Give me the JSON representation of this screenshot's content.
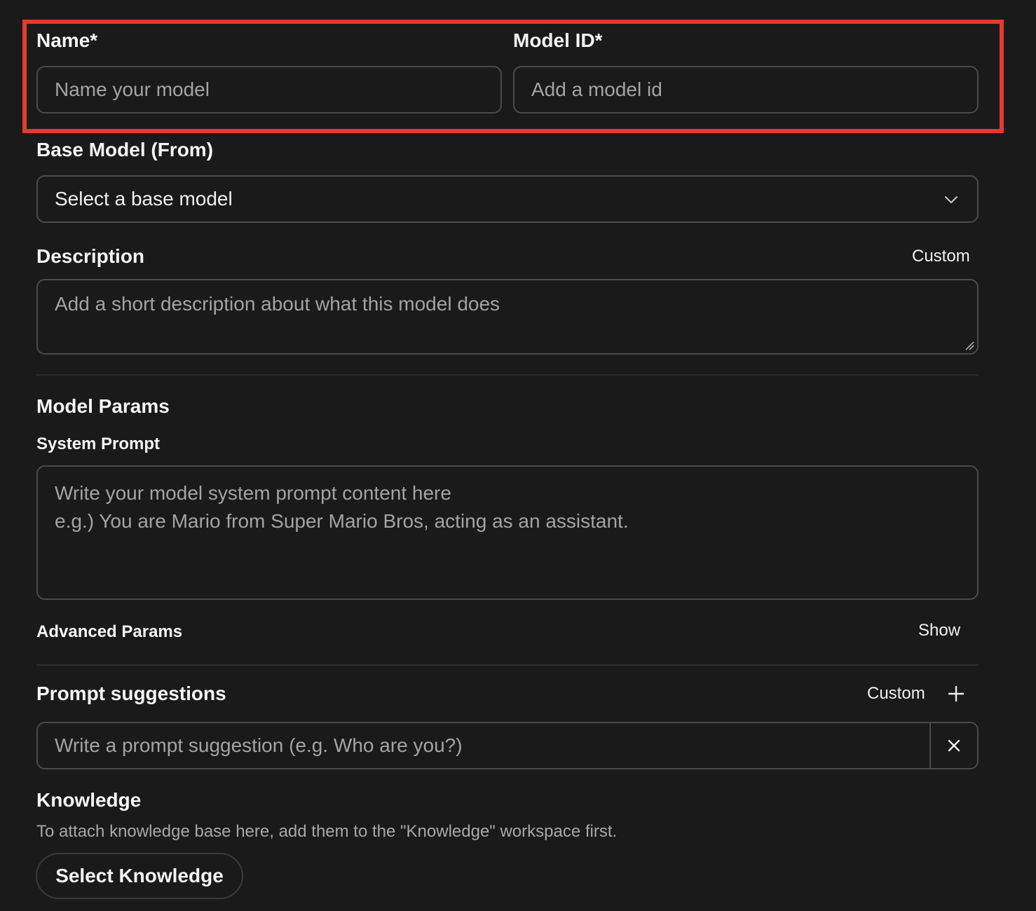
{
  "name_field": {
    "label": "Name*",
    "placeholder": "Name your model"
  },
  "model_id_field": {
    "label": "Model ID*",
    "placeholder": "Add a model id"
  },
  "base_model": {
    "label": "Base Model (From)",
    "selected": "Select a base model"
  },
  "description": {
    "label": "Description",
    "mode_toggle": "Custom",
    "placeholder": "Add a short description about what this model does"
  },
  "model_params": {
    "heading": "Model Params",
    "system_prompt_label": "System Prompt",
    "system_prompt_placeholder": "Write your model system prompt content here\ne.g.) You are Mario from Super Mario Bros, acting as an assistant.",
    "advanced_label": "Advanced Params",
    "advanced_toggle": "Show"
  },
  "prompt_suggestions": {
    "heading": "Prompt suggestions",
    "mode_toggle": "Custom",
    "placeholder": "Write a prompt suggestion (e.g. Who are you?)"
  },
  "knowledge": {
    "heading": "Knowledge",
    "help": "To attach knowledge base here, add them to the \"Knowledge\" workspace first.",
    "button": "Select Knowledge"
  },
  "colors": {
    "highlight": "#e53b2c",
    "background": "#1a1a1a",
    "border": "#4a4a4a"
  }
}
